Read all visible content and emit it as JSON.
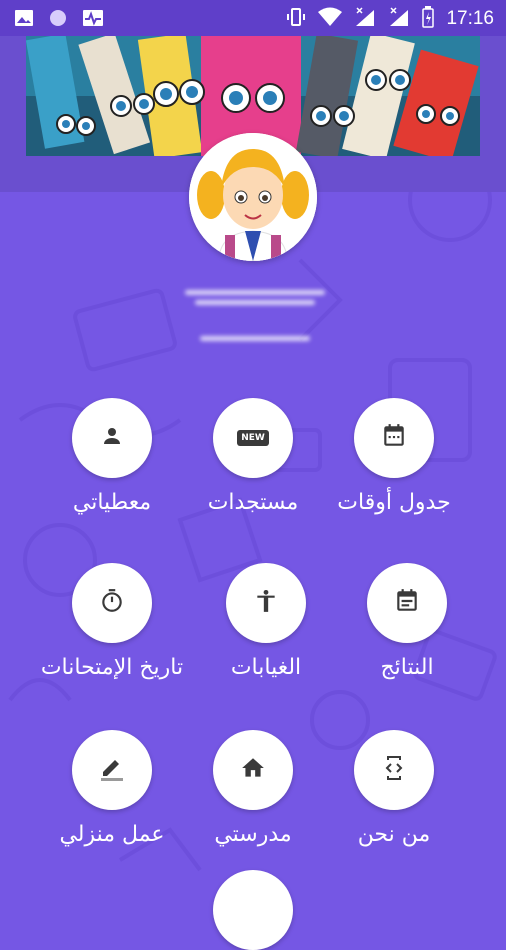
{
  "status_bar": {
    "time": "17:16",
    "icons": [
      "image-icon",
      "circle-icon",
      "activity-icon",
      "vibrate-icon",
      "wifi-icon",
      "signal-x-icon",
      "signal-x-icon",
      "battery-icon"
    ]
  },
  "colors": {
    "background": "#7557e4",
    "status_bar": "#5f3fc9",
    "icon": "#3a3a3a"
  },
  "menu": [
    {
      "label": "جدول أوقات",
      "icon": "calendar-icon"
    },
    {
      "label": "مستجدات",
      "icon": "new-badge-icon",
      "badge": "NEW"
    },
    {
      "label": "معطياتي",
      "icon": "person-icon"
    },
    {
      "label": "النتائج",
      "icon": "event-note-icon"
    },
    {
      "label": "الغيابات",
      "icon": "accessibility-icon"
    },
    {
      "label": "تاريخ الإمتحانات",
      "icon": "timer-icon"
    },
    {
      "label": "من نحن",
      "icon": "developer-mode-icon"
    },
    {
      "label": "مدرستي",
      "icon": "home-icon"
    },
    {
      "label": "عمل منزلي",
      "icon": "edit-icon"
    }
  ]
}
